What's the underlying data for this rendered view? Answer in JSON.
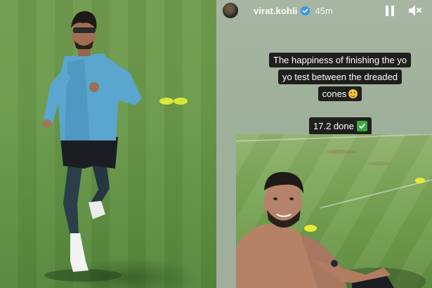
{
  "story": {
    "username": "virat.kohli",
    "time_ago": "45m",
    "caption": "The happiness of finishing the yo yo test between the dreaded cones",
    "caption_emoji": "grimacing-smile-emoji",
    "score_text": "17.2 done",
    "score_emoji": "check-mark-emoji",
    "controls": {
      "pause_icon": "pause-icon",
      "mute_icon": "speaker-muted-icon"
    },
    "verified_icon": "verified-badge-icon"
  },
  "colors": {
    "verified": "#3897f0",
    "label_bg": "#1f1f1d",
    "check": "#3aa845"
  }
}
